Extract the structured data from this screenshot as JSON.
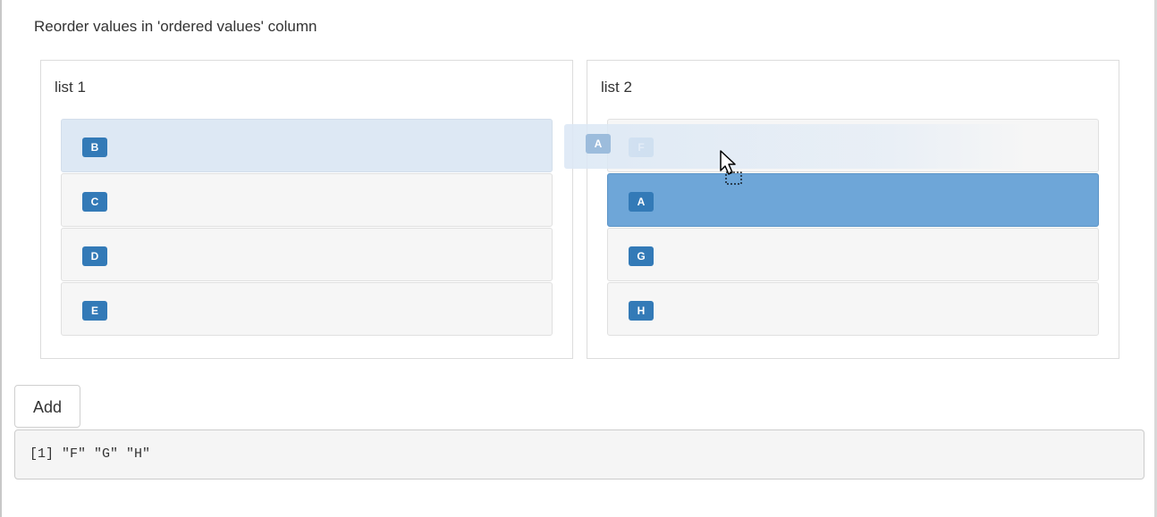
{
  "instruction": "Reorder values in 'ordered values' column",
  "list1": {
    "title": "list 1",
    "items": [
      {
        "label": "B",
        "state": "dragging-origin"
      },
      {
        "label": "C"
      },
      {
        "label": "D"
      },
      {
        "label": "E"
      }
    ]
  },
  "list2": {
    "title": "list 2",
    "items": [
      {
        "label": "F",
        "state": "faded"
      },
      {
        "label": "A",
        "state": "highlighted"
      },
      {
        "label": "G"
      },
      {
        "label": "H"
      }
    ]
  },
  "drag_ghost": {
    "label": "A"
  },
  "add_button": {
    "label": "Add"
  },
  "output": {
    "text": "[1] \"F\" \"G\" \"H\""
  },
  "colors": {
    "badge": "#337ab7",
    "highlight": "#6ea6d8",
    "faded_item": "#dde8f4"
  },
  "icons": {
    "cursor": "drag-cursor-icon"
  }
}
